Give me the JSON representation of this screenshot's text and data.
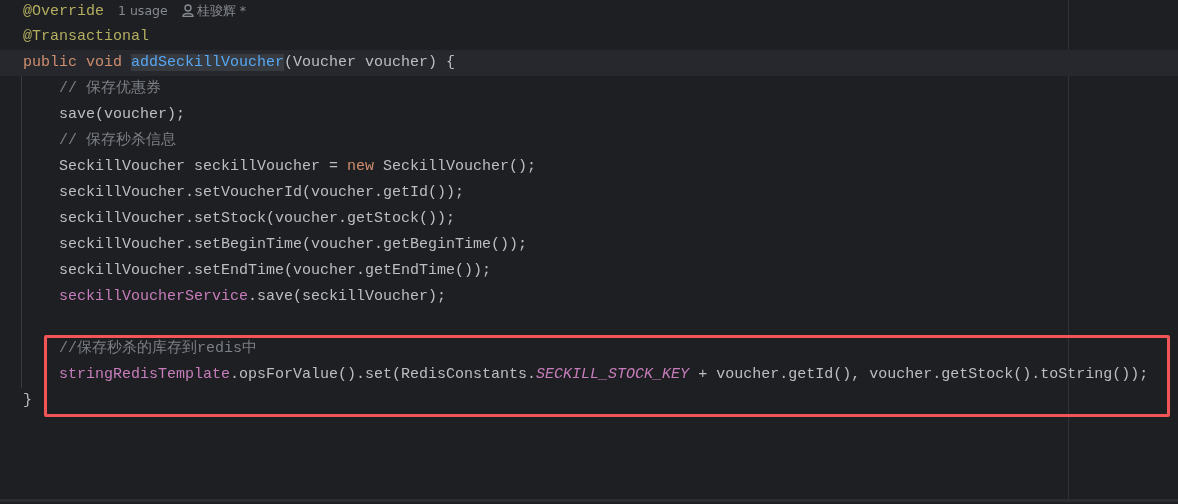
{
  "highlight_box": {
    "color": "#f25555"
  },
  "lines": [
    {
      "current": false,
      "boxed": false,
      "tokens": [
        {
          "text": "@Override",
          "kind": "annotation"
        }
      ],
      "hints": [
        {
          "text": "1 usage",
          "kind": "usage"
        },
        {
          "text": "桂骏辉 *",
          "kind": "author"
        }
      ]
    },
    {
      "current": false,
      "boxed": false,
      "tokens": [
        {
          "text": "@Transactional",
          "kind": "annotation"
        }
      ]
    },
    {
      "current": true,
      "boxed": false,
      "tokens": [
        {
          "text": "public void ",
          "kind": "keyword"
        },
        {
          "text": "addSeckillVoucher",
          "kind": "method-occurrence"
        },
        {
          "text": "(Voucher voucher) {",
          "kind": "plain"
        }
      ],
      "children": [
        {
          "current": false,
          "boxed": false,
          "tokens": [
            {
              "text": "// 保存优惠券",
              "kind": "comment"
            }
          ]
        },
        {
          "current": false,
          "boxed": false,
          "tokens": [
            {
              "text": "save(voucher);",
              "kind": "plain"
            }
          ]
        },
        {
          "current": false,
          "boxed": false,
          "tokens": [
            {
              "text": "// 保存秒杀信息",
              "kind": "comment"
            }
          ]
        },
        {
          "current": false,
          "boxed": false,
          "tokens": [
            {
              "text": "SeckillVoucher seckillVoucher = ",
              "kind": "plain"
            },
            {
              "text": "new",
              "kind": "keyword"
            },
            {
              "text": " SeckillVoucher();",
              "kind": "plain"
            }
          ]
        },
        {
          "current": false,
          "boxed": false,
          "tokens": [
            {
              "text": "seckillVoucher.setVoucherId(voucher.getId());",
              "kind": "plain"
            }
          ]
        },
        {
          "current": false,
          "boxed": false,
          "tokens": [
            {
              "text": "seckillVoucher.setStock(voucher.getStock());",
              "kind": "plain"
            }
          ]
        },
        {
          "current": false,
          "boxed": false,
          "tokens": [
            {
              "text": "seckillVoucher.setBeginTime(voucher.getBeginTime());",
              "kind": "plain"
            }
          ]
        },
        {
          "current": false,
          "boxed": false,
          "tokens": [
            {
              "text": "seckillVoucher.setEndTime(voucher.getEndTime());",
              "kind": "plain"
            }
          ]
        },
        {
          "current": false,
          "boxed": false,
          "tokens": [
            {
              "text": "seckillVoucherService",
              "kind": "field"
            },
            {
              "text": ".save(seckillVoucher);",
              "kind": "plain"
            }
          ]
        },
        {
          "current": false,
          "boxed": false
        },
        {
          "current": false,
          "boxed": true,
          "tokens": [
            {
              "text": "//保存秒杀的库存到redis中",
              "kind": "comment"
            }
          ]
        },
        {
          "current": false,
          "boxed": true,
          "tokens": [
            {
              "text": "stringRedisTemplate",
              "kind": "field"
            },
            {
              "text": ".opsForValue().set(RedisConstants.",
              "kind": "plain"
            },
            {
              "text": "SECKILL_STOCK_KEY",
              "kind": "constant"
            },
            {
              "text": " + voucher.getId(), voucher.getStock().toString());",
              "kind": "plain"
            }
          ]
        }
      ]
    },
    {
      "current": false,
      "boxed": false,
      "tokens": [
        {
          "text": "}",
          "kind": "plain"
        }
      ]
    }
  ]
}
